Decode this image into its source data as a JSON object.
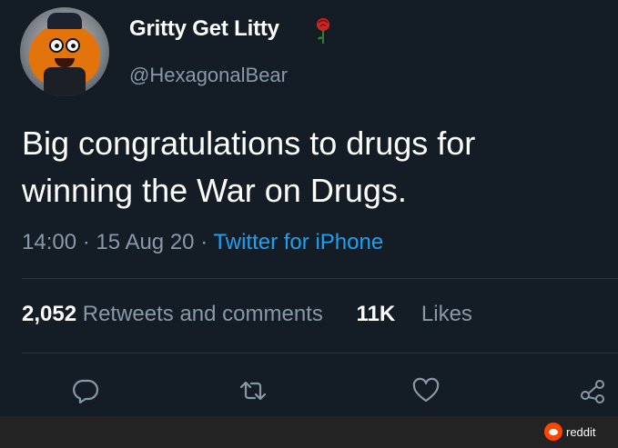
{
  "user": {
    "display_name": "Gritty Get Litty",
    "handle": "@HexagonalBear",
    "name_emoji_icon": "rose-icon"
  },
  "tweet": {
    "text_lines": [
      "Big congratulations to drugs for",
      "winning the War on Drugs."
    ],
    "time": "14:00",
    "separator": "·",
    "date": "15 Aug 20",
    "source": "Twitter for iPhone"
  },
  "stats": {
    "retweets_count": "2,052",
    "retweets_label": "Retweets and comments",
    "likes_count": "11K",
    "likes_label": "Likes"
  },
  "actions": [
    {
      "icon": "reply-icon"
    },
    {
      "icon": "retweet-icon"
    },
    {
      "icon": "like-icon"
    },
    {
      "icon": "share-icon"
    }
  ],
  "watermark": {
    "text": "reddit",
    "icon": "reddit-icon"
  },
  "colors": {
    "background": "#141d26",
    "secondary_text": "#8899a6",
    "link": "#1da1f2",
    "divider": "#2a3540"
  }
}
